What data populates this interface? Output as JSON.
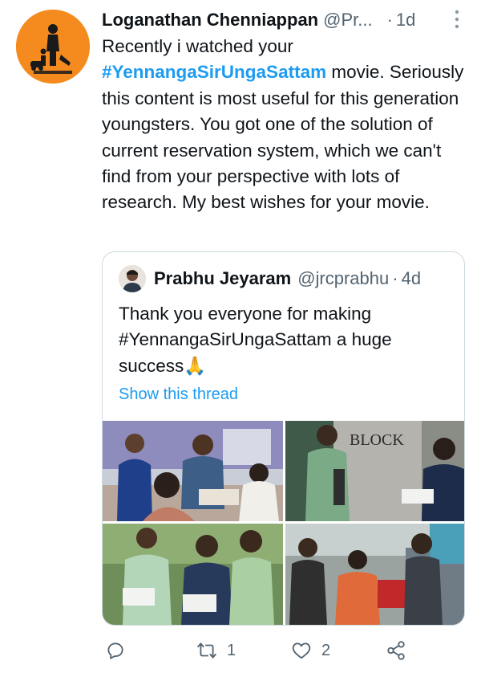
{
  "tweet": {
    "author_name": "Loganathan Chenniappan",
    "author_handle": "@Pr...",
    "separator": "·",
    "time": "1d",
    "text_before": "Recently i watched your ",
    "hashtag": "#YennangaSirUngaSattam",
    "text_after": " movie. Seriously this content is most useful for this generation youngsters. You got one of the solution of current reservation system, which we can't find from your perspective with lots of research. My best wishes for your  movie."
  },
  "quoted": {
    "author_name": "Prabhu Jeyaram",
    "author_handle": "@jrcprabhu",
    "separator": "·",
    "time": "4d",
    "text": "Thank you everyone for making #YennangaSirUngaSattam a huge success🙏",
    "show_thread": "Show this thread",
    "photos": [
      "photo-1",
      "photo-2",
      "photo-3",
      "photo-4"
    ],
    "photo_sign": "BLOCK"
  },
  "actions": {
    "reply_count": "",
    "retweet_count": "1",
    "like_count": "2"
  },
  "icons": {
    "reply": "reply-icon",
    "retweet": "retweet-icon",
    "like": "like-icon",
    "share": "share-icon",
    "more": "more-vertical-icon"
  },
  "colors": {
    "accent": "#1d9bf0",
    "secondary_text": "#536471",
    "avatar_bg": "#f58b1f"
  }
}
